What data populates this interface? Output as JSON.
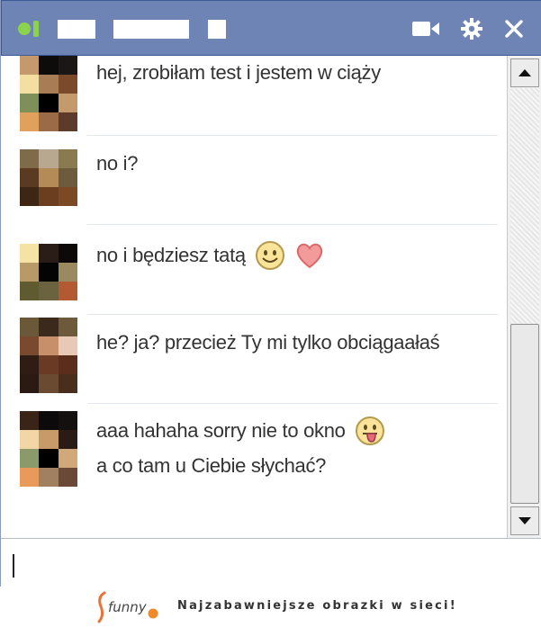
{
  "titlebar": {
    "status": "online",
    "video_icon": "video-camera-icon",
    "settings_icon": "gear-icon",
    "close_icon": "close-icon"
  },
  "messages": [
    {
      "text": "hej, zrobiłam test i jestem w ciąży",
      "emojis": []
    },
    {
      "text": "no i?",
      "emojis": []
    },
    {
      "text": "no i będziesz tatą",
      "emojis": [
        "smile-emoji",
        "heart-emoji"
      ]
    },
    {
      "text": "he? ja? przecież Ty mi tylko obciągaałaś",
      "emojis": []
    },
    {
      "text": "aaa hahaha sorry nie to okno",
      "emojis": [
        "tongue-emoji"
      ]
    },
    {
      "text": "a co tam u Ciebie słychać?",
      "emojis": []
    }
  ],
  "composer": {
    "value": ""
  },
  "footer": {
    "logo_text": "funny",
    "tagline": "Najzabawniejsze obrazki w sieci!"
  },
  "colors": {
    "titlebar": "#6d84b4",
    "online": "#8bd34a",
    "text": "#333333"
  }
}
